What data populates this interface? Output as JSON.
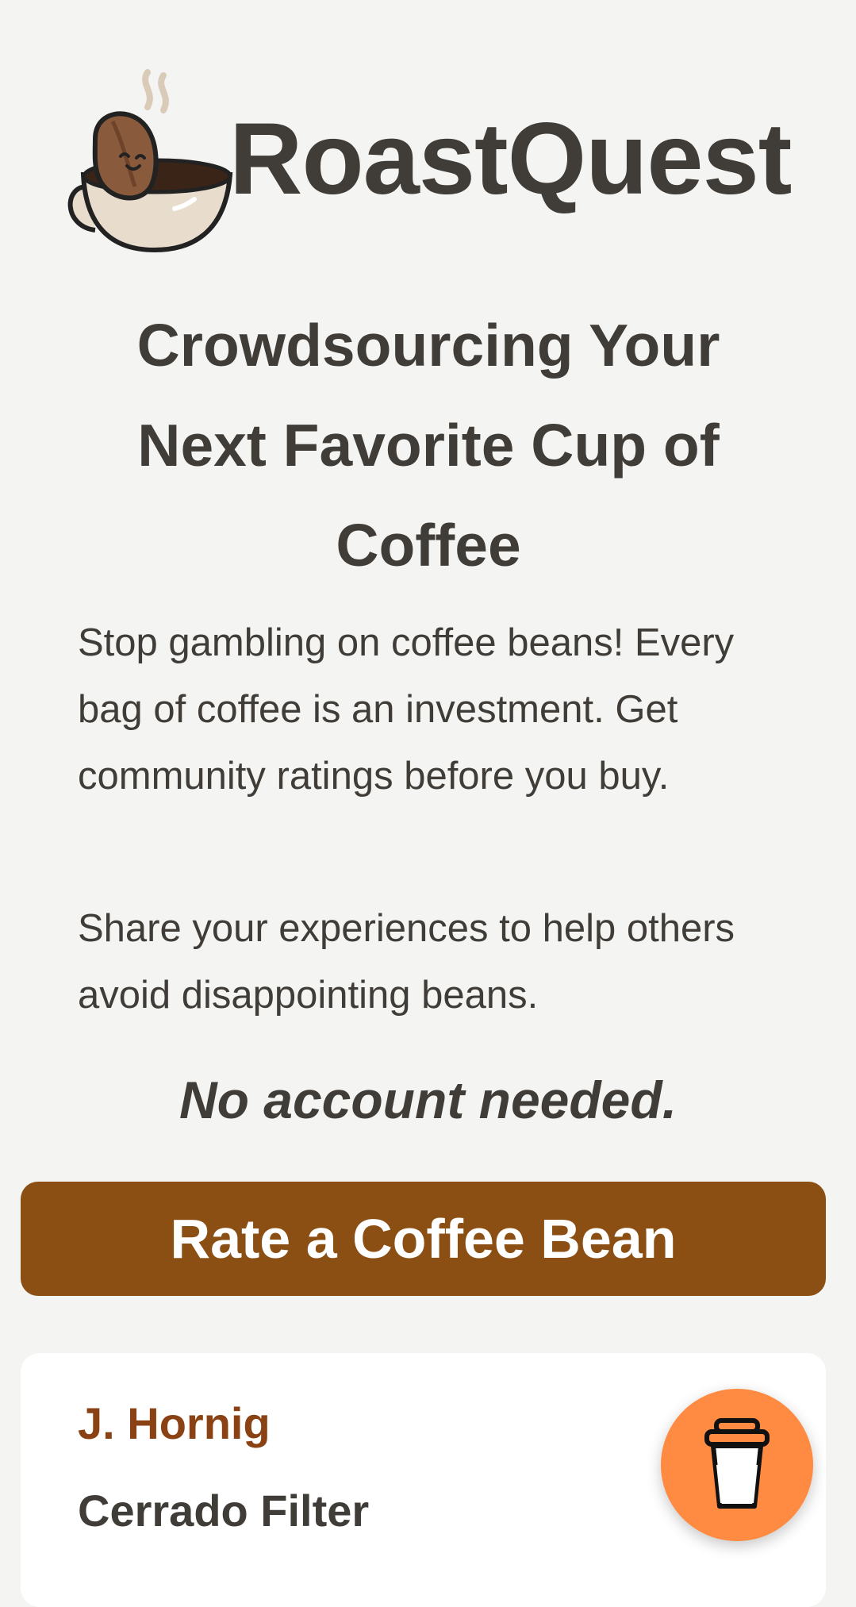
{
  "brand": {
    "name": "RoastQuest",
    "logo_icon": "coffee-bean-in-cup-icon"
  },
  "hero": {
    "headline": "Crowdsourcing Your Next Favorite Cup of Coffee",
    "paragraph_1": "Stop gambling on coffee beans! Every bag of coffee is an investment. Get community ratings before you buy.",
    "paragraph_2": "Share your experiences to help others avoid disappointing beans.",
    "no_account": "No account needed."
  },
  "cta": {
    "label": "Rate a Coffee Bean"
  },
  "review_card": {
    "author": "J. Hornig",
    "bean": "Cerrado Filter"
  },
  "fab": {
    "icon": "coffee-cup-icon"
  },
  "colors": {
    "background": "#f4f4f2",
    "text": "#403d38",
    "cta": "#8b4f13",
    "author": "#8a4214",
    "fab": "#ff8a42"
  }
}
